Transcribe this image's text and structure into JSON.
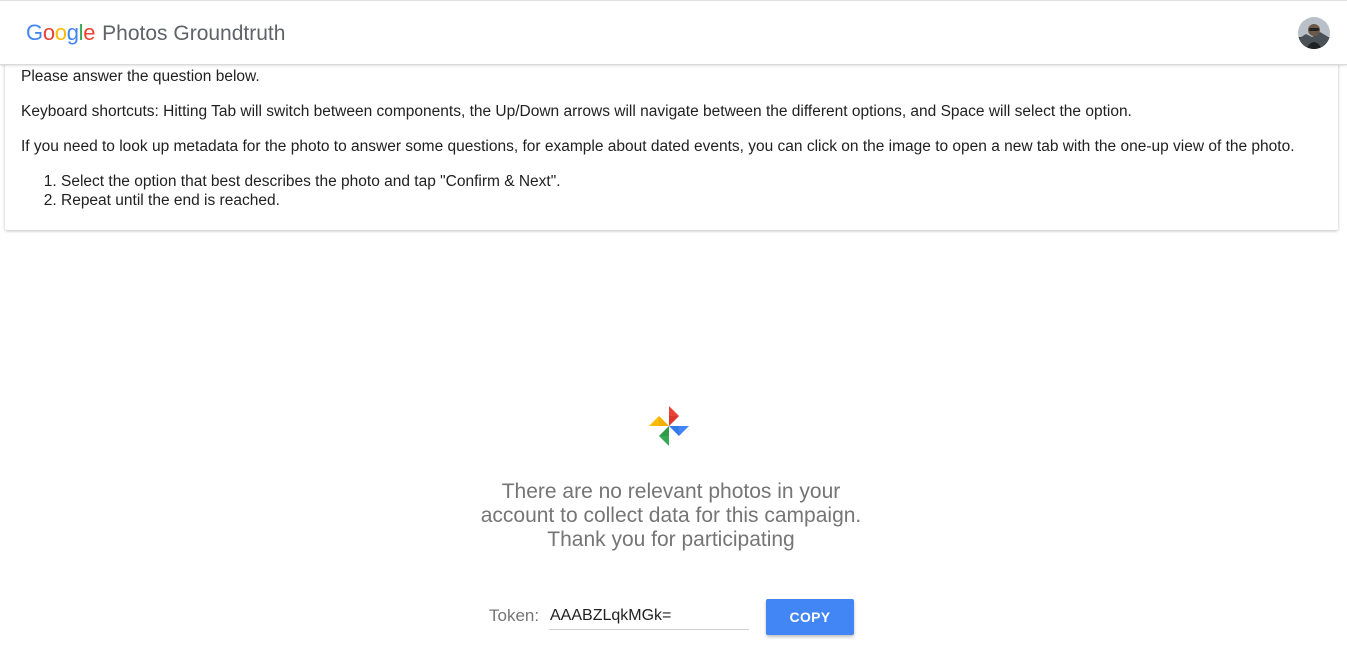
{
  "header": {
    "logo_text": "Google",
    "app_name": "Photos Groundtruth",
    "avatar_icon": "user-avatar"
  },
  "instructions": {
    "intro": "Please answer the question below.",
    "shortcuts": "Keyboard shortcuts: Hitting Tab will switch between components, the Up/Down arrows will navigate between the different options, and Space will select the option.",
    "metadata": "If you need to look up metadata for the photo to answer some questions, for example about dated events, you can click on the image to open a new tab with the one-up view of the photo.",
    "steps": [
      "Select the option that best describes the photo and tap \"Confirm & Next\".",
      "Repeat until the end is reached."
    ]
  },
  "empty_state": {
    "icon": "google-photos-pinwheel",
    "lines": [
      "There are no relevant photos in your",
      "account to collect data for this campaign.",
      "Thank you for participating"
    ]
  },
  "token": {
    "label": "Token:",
    "value": "AAABZLqkMGk=",
    "copy_label": "COPY"
  },
  "colors": {
    "google_blue": "#4285f4",
    "google_red": "#ea4335",
    "google_yellow": "#fbbc05",
    "google_green": "#34a853",
    "muted_text": "#757575"
  }
}
